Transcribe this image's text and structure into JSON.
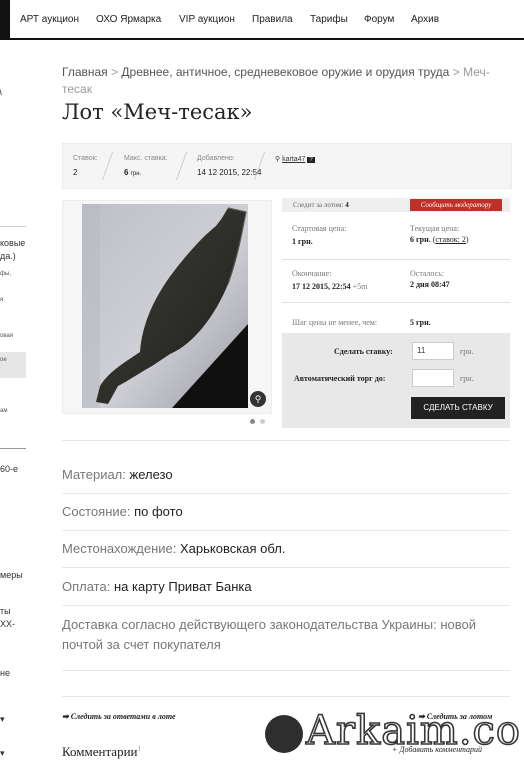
{
  "nav": {
    "items": [
      "АРТ аукцион",
      "ОХО Ярмарка",
      "VIP аукцион",
      "Правила",
      "Тарифы",
      "Форум",
      "Архив"
    ]
  },
  "sidebar": {
    "fragments": [
      "ковые",
      "да.)",
      "фы,",
      "я",
      "овая",
      "ое",
      "ам",
      "60-е",
      "меры",
      "ты",
      "XX-",
      "не"
    ]
  },
  "breadcrumb": {
    "home": "Главная",
    "sep": ">",
    "category": "Древнее, античное, средневековое оружие и орудия труда",
    "current": "Меч-тесак"
  },
  "lot": {
    "title": "Лот «Меч-тесак»"
  },
  "stats": {
    "bids_label": "Ставок:",
    "bids_value": "2",
    "max_label": "Макс. ставка:",
    "max_value": "6",
    "max_unit": "грн.",
    "added_label": "Добавлено:",
    "added_value": "14 12 2015, 22:54",
    "seller": "karta47"
  },
  "auction": {
    "followers_label": "Следит за лотом:",
    "followers_value": "4",
    "report_label": "Сообщить модератору",
    "start_label": "Стартовая цена:",
    "start_value": "1 грн.",
    "current_label": "Текущая цена:",
    "current_value": "6 грн.",
    "bids_link": "ставок: 2",
    "end_label": "Окончание:",
    "end_value": "17 12 2015, 22:54",
    "end_extra": "+5m",
    "left_label": "Осталось:",
    "left_value": "2 дня 08:47",
    "step_label": "Шаг цены не менее, чем:",
    "step_value": "5 грн.",
    "bid_label": "Сделать ставку:",
    "bid_value": "11",
    "currency": "грн.",
    "auto_label": "Автоматический торг до:",
    "auto_value": "",
    "bid_button": "СДЕЛАТЬ СТАВКУ"
  },
  "attributes": [
    {
      "key": "Материал:",
      "value": "железо"
    },
    {
      "key": "Состояние:",
      "value": "по фото"
    },
    {
      "key": "Местонахождение:",
      "value": "Харьковская обл."
    },
    {
      "key": "Оплата:",
      "value": "на карту Приват Банка"
    },
    {
      "key": "Доставка",
      "value": "согласно действующего законодательства Украины: новой почтой за счет покупателя"
    }
  ],
  "footer": {
    "follow_answers": "➡ Следить за ответами в лоте",
    "follow_lot": "➡ Следить за лотом",
    "comments_label": "Комментарии",
    "comments_count": "1",
    "add_comment": "+ Добавить комментарий",
    "watermark": "Arkaim.co"
  },
  "colors": {
    "accent_red": "#c0302a",
    "button_dark": "#222222"
  }
}
